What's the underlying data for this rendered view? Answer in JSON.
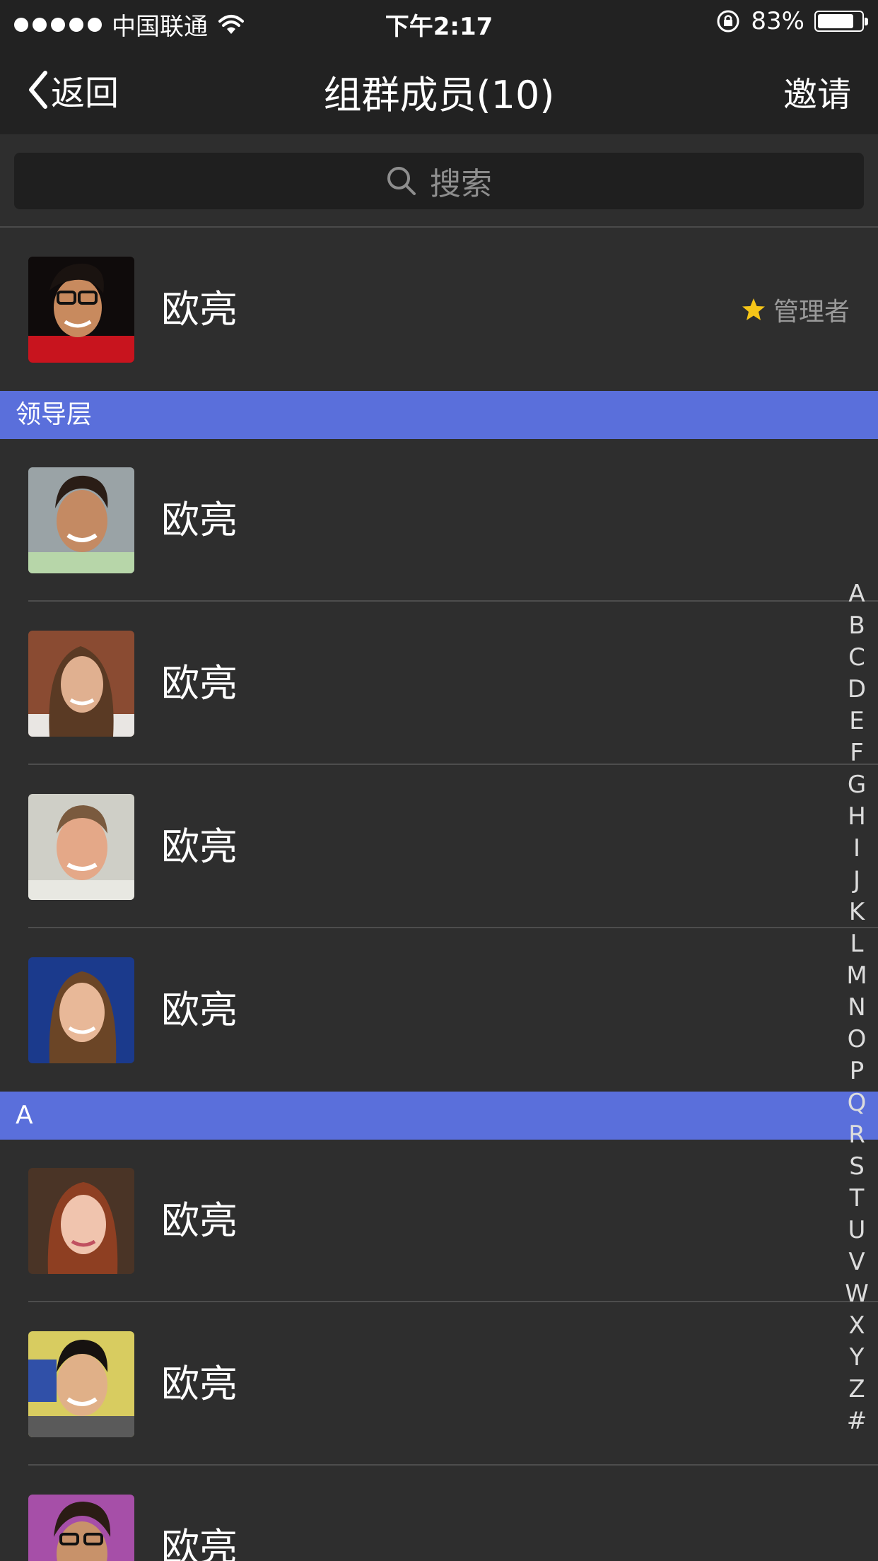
{
  "status_bar": {
    "carrier": "中国联通",
    "time": "下午2:17",
    "battery_percent": "83%",
    "battery_level": 0.83
  },
  "nav": {
    "back_label": "返回",
    "title": "组群成员(10)",
    "invite_label": "邀请"
  },
  "search": {
    "placeholder": "搜索"
  },
  "admin_member": {
    "name": "欧亮",
    "role_label": "管理者"
  },
  "sections": [
    {
      "title": "领导层",
      "members": [
        {
          "name": "欧亮"
        },
        {
          "name": "欧亮"
        },
        {
          "name": "欧亮"
        },
        {
          "name": "欧亮"
        }
      ]
    },
    {
      "title": "A",
      "members": [
        {
          "name": "欧亮"
        },
        {
          "name": "欧亮"
        },
        {
          "name": "欧亮"
        }
      ]
    }
  ],
  "index_letters": [
    "A",
    "B",
    "C",
    "D",
    "E",
    "F",
    "G",
    "H",
    "I",
    "J",
    "K",
    "L",
    "M",
    "N",
    "O",
    "P",
    "Q",
    "R",
    "S",
    "T",
    "U",
    "V",
    "W",
    "X",
    "Y",
    "Z",
    "#"
  ],
  "colors": {
    "section_header": "#5a6fdb",
    "background": "#2e2e2e",
    "bar": "#222222",
    "star": "#f5c518"
  },
  "icons": {
    "back": "chevron-left-icon",
    "search": "search-icon",
    "star": "star-icon",
    "wifi": "wifi-icon",
    "rotation_lock": "rotation-lock-icon",
    "battery": "battery-icon"
  }
}
